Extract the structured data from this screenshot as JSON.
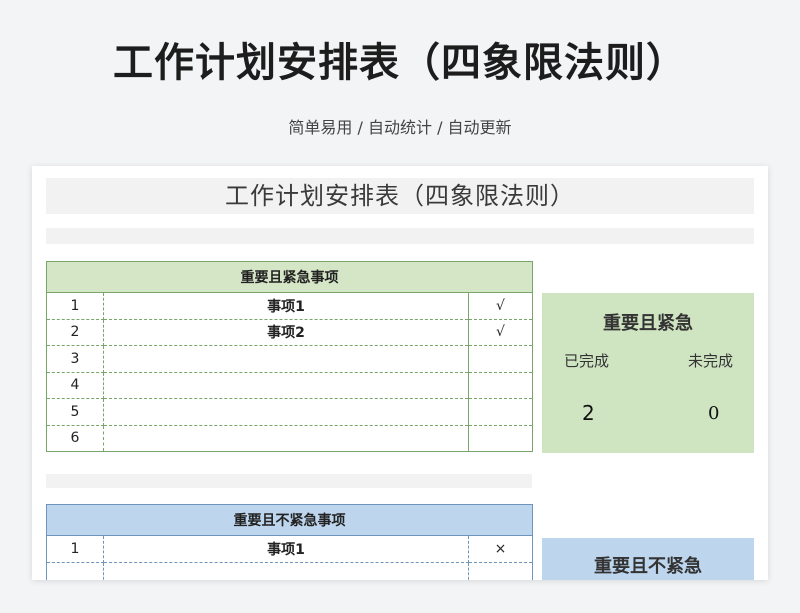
{
  "hero": {
    "title": "工作计划安排表（四象限法则）",
    "subtitle": "简单易用  /  自动统计  /  自动更新"
  },
  "sheet": {
    "title": "工作计划安排表（四象限法则）"
  },
  "quadrant1": {
    "header": "重要且紧急事项",
    "rows": [
      {
        "no": "1",
        "item": "事项1",
        "check": "√"
      },
      {
        "no": "2",
        "item": "事项2",
        "check": "√"
      },
      {
        "no": "3",
        "item": "",
        "check": ""
      },
      {
        "no": "4",
        "item": "",
        "check": ""
      },
      {
        "no": "5",
        "item": "",
        "check": ""
      },
      {
        "no": "6",
        "item": "",
        "check": ""
      }
    ],
    "summary": {
      "title": "重要且紧急",
      "done_label": "已完成",
      "undone_label": "未完成",
      "done_value": "2",
      "undone_value": "0"
    }
  },
  "quadrant2": {
    "header": "重要且不紧急事项",
    "rows": [
      {
        "no": "1",
        "item": "事项1",
        "check": "×"
      }
    ],
    "summary": {
      "title": "重要且不紧急"
    }
  },
  "colors": {
    "green_header": "#d5e6c6",
    "blue_header": "#bdd6ee",
    "green_border": "#7aa56a",
    "blue_border": "#6f95bd"
  }
}
